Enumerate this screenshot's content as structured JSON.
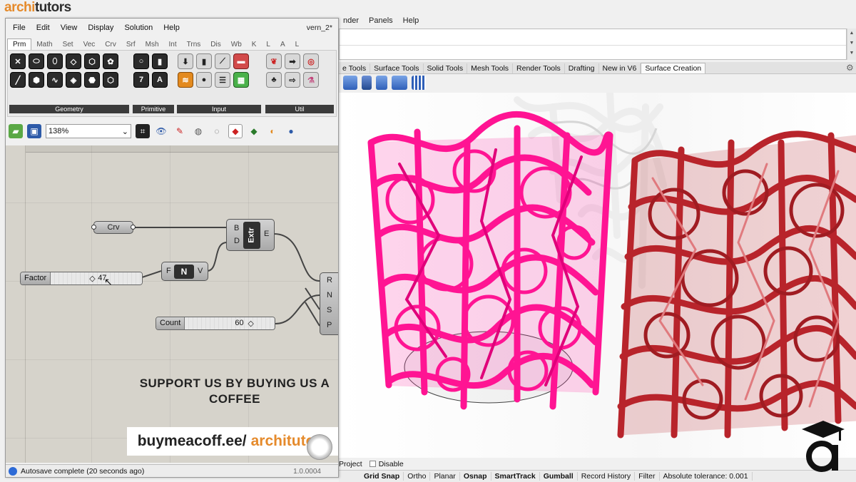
{
  "logo": {
    "part1": "archi",
    "part2": "tutors"
  },
  "rhino": {
    "menu": [
      "nder",
      "Panels",
      "Help"
    ],
    "tabs": [
      "e Tools",
      "Surface Tools",
      "Solid Tools",
      "Mesh Tools",
      "Render Tools",
      "Drafting",
      "New in V6",
      "Surface Creation"
    ],
    "active_tab": "Surface Creation",
    "bottom_options": {
      "project": "Project",
      "disable": "Disable"
    },
    "status": [
      "Grid Snap",
      "Ortho",
      "Planar",
      "Osnap",
      "SmartTrack",
      "Gumball",
      "Record History",
      "Filter",
      "Absolute tolerance: 0.001"
    ],
    "status_bold": [
      "Grid Snap",
      "Osnap",
      "SmartTrack",
      "Gumball"
    ]
  },
  "gh": {
    "menu": [
      "File",
      "Edit",
      "View",
      "Display",
      "Solution",
      "Help"
    ],
    "doc_title": "vern_2*",
    "category_tabs": [
      "Prm",
      "Math",
      "Set",
      "Vec",
      "Crv",
      "Srf",
      "Msh",
      "Int",
      "Trns",
      "Dis",
      "Wb",
      "K",
      "L",
      "A",
      "L"
    ],
    "active_category": "Prm",
    "groups": {
      "geometry": "Geometry",
      "primitive": "Primitive",
      "input": "Input",
      "util": "Util"
    },
    "zoom": "138%",
    "canvas": {
      "crv": "Crv",
      "extr": {
        "title": "Extr",
        "in1": "B",
        "in2": "D",
        "out": "E"
      },
      "normal": {
        "title": "N",
        "in": "F",
        "out": "V"
      },
      "factor_slider": {
        "label": "Factor",
        "value": "47"
      },
      "count_slider": {
        "label": "Count",
        "value": "60"
      },
      "last": {
        "in1": "R",
        "in2": "N",
        "in3": "S",
        "in4": "P"
      }
    },
    "support_text": "SUPPORT US BY BUYING US A COFFEE",
    "coffee_url": "buymeacoff.ee/",
    "coffee_brand": "architutors",
    "status": "Autosave complete (20 seconds ago)",
    "version": "1.0.0004"
  },
  "colors": {
    "pink": "#ff1493",
    "red": "#c1272d",
    "brand_orange": "#e58a2b"
  }
}
